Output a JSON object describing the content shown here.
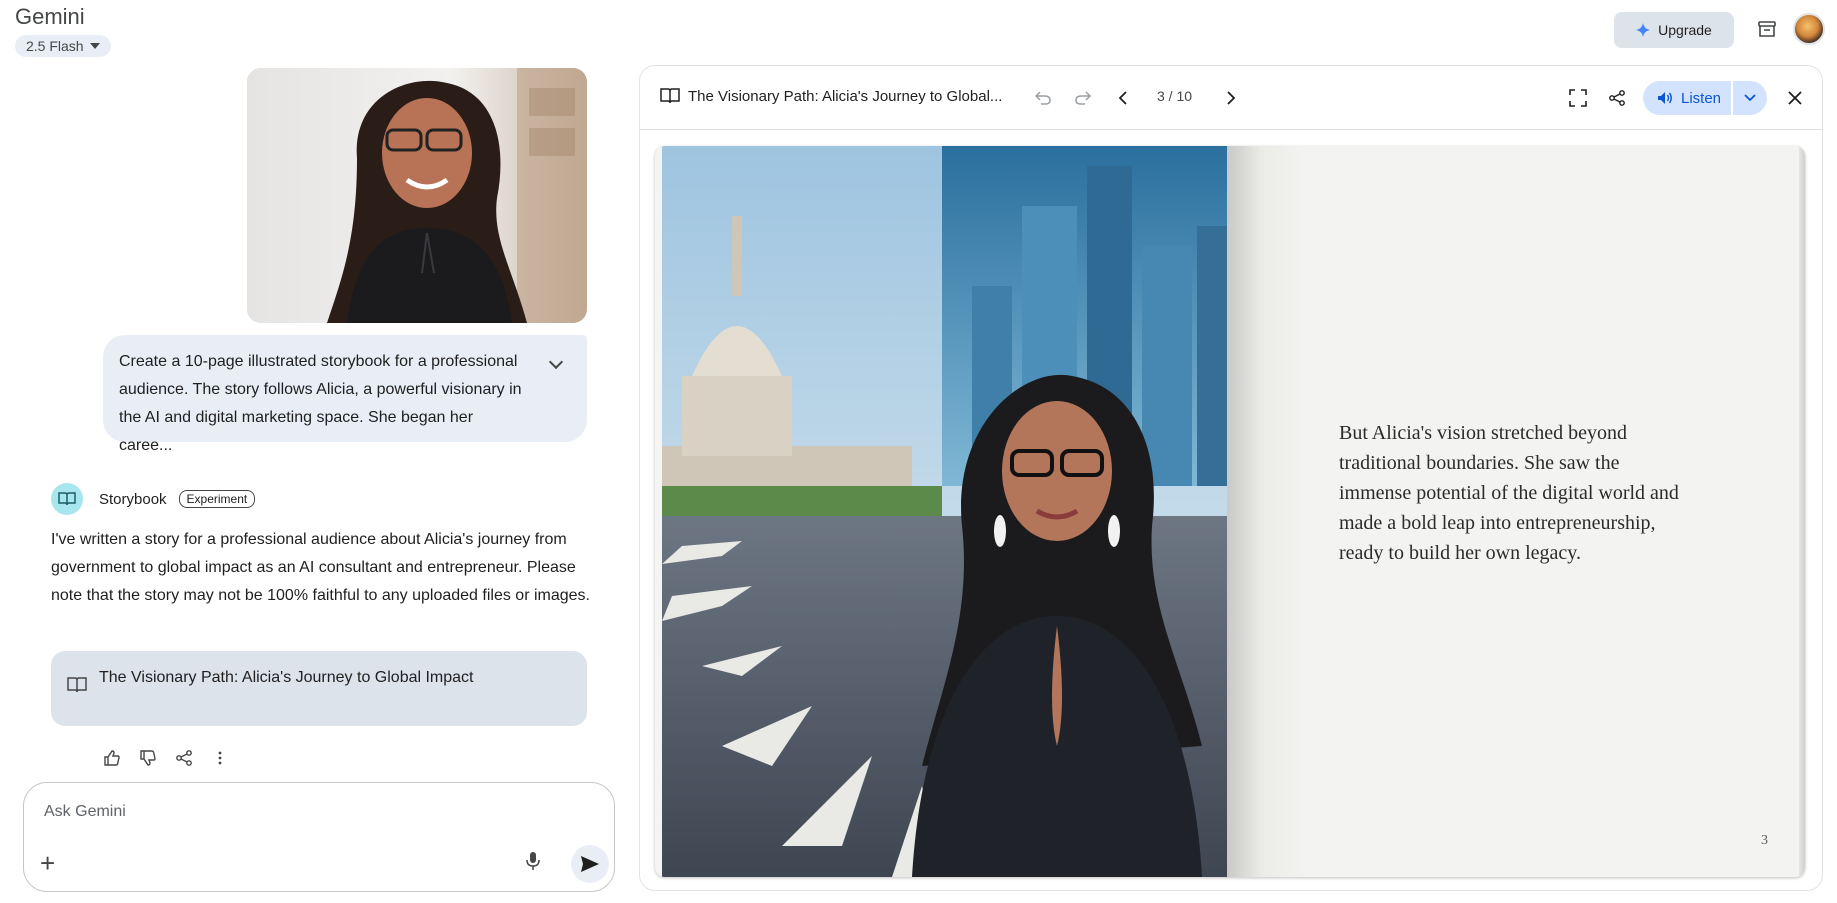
{
  "header": {
    "app_title": "Gemini",
    "model": "2.5 Flash",
    "upgrade_label": "Upgrade"
  },
  "conversation": {
    "user_message": "Create a 10-page illustrated storybook for a professional audience. The story follows Alicia, a powerful visionary in the AI and digital marketing space. She began her caree...",
    "assistant_name": "Storybook",
    "assistant_badge": "Experiment",
    "response_text": "I've written a story for a professional audience about Alicia's journey from government to global impact as an AI consultant and entrepreneur. Please note that the story may not be 100% faithful to any uploaded files or images.",
    "story_card_title": "The Visionary Path: Alicia's Journey to Global Impact"
  },
  "composer": {
    "placeholder": "Ask Gemini"
  },
  "viewer": {
    "title": "The Visionary Path: Alicia's Journey to Global...",
    "page_indicator": "3 / 10",
    "listen_label": "Listen",
    "page_text": "But Alicia's vision stretched beyond traditional boundaries. She saw the immense potential of the digital world and made a bold leap into entrepreneurship, ready to build her own legacy.",
    "page_number": "3"
  },
  "colors": {
    "accent": "#0b57d0",
    "listen_bg": "#d3e3fd",
    "user_bubble": "#e9eef6",
    "card_bg": "#dde3ea"
  }
}
